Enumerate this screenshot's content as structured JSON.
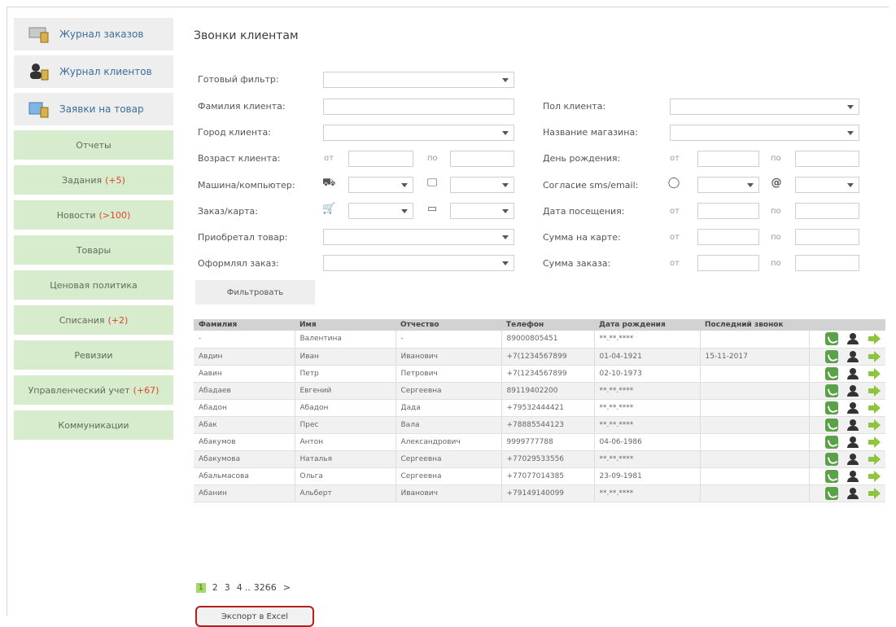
{
  "sidebar": {
    "top": [
      {
        "label": "Журнал заказов",
        "icon": "order-journal-icon"
      },
      {
        "label": "Журнал клиентов",
        "icon": "clients-icon"
      },
      {
        "label": "Заявки на товар",
        "icon": "goods-request-icon"
      }
    ],
    "items": [
      {
        "label": "Отчеты",
        "badge": ""
      },
      {
        "label": "Задания",
        "badge": "(+5)"
      },
      {
        "label": "Новости",
        "badge": "(>100)"
      },
      {
        "label": "Товары",
        "badge": ""
      },
      {
        "label": "Ценовая политика",
        "badge": ""
      },
      {
        "label": "Списания",
        "badge": "(+2)"
      },
      {
        "label": "Ревизии",
        "badge": ""
      },
      {
        "label": "Управленческий учет",
        "badge": "(+67)"
      },
      {
        "label": "Коммуникации",
        "badge": ""
      }
    ]
  },
  "page": {
    "title": "Звонки клиентам"
  },
  "filters": {
    "ready_filter": "Готовый фильтр:",
    "surname": "Фамилия клиента:",
    "gender": "Пол клиента:",
    "city": "Город клиента:",
    "store": "Название магазина:",
    "age": "Возраст клиента:",
    "birthday": "День рождения:",
    "car_pc": "Машина/компьютер:",
    "consent": "Согласие sms/email:",
    "order_card": "Заказ/карта:",
    "visit_date": "Дата посещения:",
    "bought": "Приобретал товар:",
    "card_sum": "Сумма на карте:",
    "ordered": "Оформлял заказ:",
    "order_sum": "Сумма заказа:",
    "from": "от",
    "to": "по",
    "button": "Фильтровать"
  },
  "table": {
    "headers": [
      "Фамилия",
      "Имя",
      "Отчество",
      "Телефон",
      "Дата рождения",
      "Последний звонок"
    ],
    "rows": [
      [
        "-",
        "Валентина",
        "-",
        "89000805451",
        "**.**.****",
        ""
      ],
      [
        "Авдин",
        "Иван",
        "Иванович",
        "+7(1234567899",
        "01-04-1921",
        "15-11-2017"
      ],
      [
        "Аавин",
        "Петр",
        "Петрович",
        "+7(1234567899",
        "02-10-1973",
        ""
      ],
      [
        "Абадаев",
        "Евгений",
        "Сергеевна",
        "89119402200",
        "**.**.****",
        ""
      ],
      [
        "Абадон",
        "Абадон",
        "Дада",
        "+79532444421",
        "**.**.****",
        ""
      ],
      [
        "Абак",
        "Прес",
        "Вала",
        "+78885544123",
        "**.**.****",
        ""
      ],
      [
        "Абакумов",
        "Антон",
        "Александрович",
        "9999777788",
        "04-06-1986",
        ""
      ],
      [
        "Абакумова",
        "Наталья",
        "Сергеевна",
        "+77029533556",
        "**.**.****",
        ""
      ],
      [
        "Абальмасова",
        "Ольга",
        "Сергеевна",
        "+77077014385",
        "23-09-1981",
        ""
      ],
      [
        "Абанин",
        "Альберт",
        "Иванович",
        "+79149140099",
        "**.**.****",
        ""
      ]
    ]
  },
  "pager": {
    "current": "1",
    "p2": "2",
    "p3": "3",
    "p4": "4",
    "dots": "..",
    "last": "3266",
    "next": ">"
  },
  "export": {
    "label": "Экспорт в Excel"
  },
  "colors": {
    "nav_green": "#d7ebcd",
    "badge": "#e0452d",
    "export_border": "#b21f1f",
    "pager_current": "#a7d66a"
  }
}
